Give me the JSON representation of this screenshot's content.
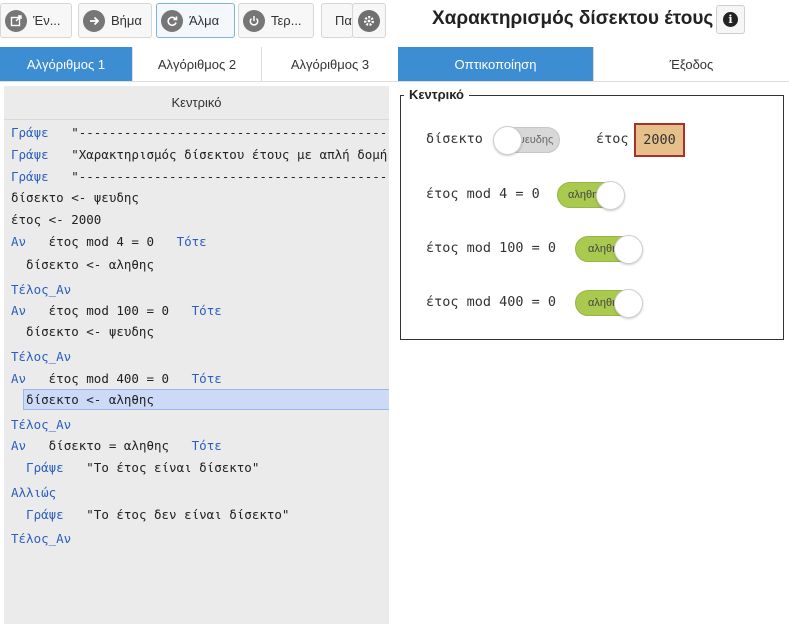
{
  "toolbar": {
    "buttons": [
      {
        "label": "Έν...",
        "icon": "export-icon"
      },
      {
        "label": "Βήμα",
        "icon": "arrow-right-icon"
      },
      {
        "label": "Άλμα",
        "icon": "redo-icon"
      },
      {
        "label": "Τερ...",
        "icon": "power-icon"
      },
      {
        "label": "Πα",
        "icon": ""
      },
      {
        "label": "",
        "icon": "gear-icon"
      }
    ]
  },
  "app": {
    "title": "Χαρακτηρισμός δίσεκτου έτους",
    "info_icon": "info-icon"
  },
  "tabs_left": [
    "Αλγόριθμος 1",
    "Αλγόριθμος 2",
    "Αλγόριθμος 3"
  ],
  "tabs_right": [
    "Οπτικοποίηση",
    "Έξοδος"
  ],
  "code": {
    "header": "Κεντρικό",
    "lines": [
      {
        "kw": "Γράψε",
        "text": "   \"--------------------------------------------------"
      },
      {
        "kw": "Γράψε",
        "text": "   \"Χαρακτηρισμός δίσεκτου έτους με απλή δομή"
      },
      {
        "kw": "Γράψε",
        "text": "   \"--------------------------------------------------"
      },
      {
        "kw": "",
        "text": "δίσεκτο <- ψευδης"
      },
      {
        "kw": "",
        "text": "έτος <- 2000"
      },
      {
        "kw": "Αν",
        "text": "   έτος mod 4 = 0   ",
        "kw2": "Τότε"
      },
      {
        "kw": "",
        "text": "  δίσεκτο <- αληθης"
      },
      {
        "kw": "Τέλος_Αν",
        "text": ""
      },
      {
        "kw": "Αν",
        "text": "   έτος mod 100 = 0   ",
        "kw2": "Τότε"
      },
      {
        "kw": "",
        "text": "  δίσεκτο <- ψευδης"
      },
      {
        "kw": "Τέλος_Αν",
        "text": ""
      },
      {
        "kw": "Αν",
        "text": "   έτος mod 400 = 0   ",
        "kw2": "Τότε"
      },
      {
        "kw": "",
        "text": "  δίσεκτο <- αληθης"
      },
      {
        "kw": "Τέλος_Αν",
        "text": ""
      },
      {
        "kw": "Αν",
        "text": "   δίσεκτο = αληθης   ",
        "kw2": "Τότε"
      },
      {
        "kw": "  Γράψε",
        "text": "   \"Το έτος είναι δίσεκτο\""
      },
      {
        "kw": "Αλλιώς",
        "text": ""
      },
      {
        "kw": "  Γράψε",
        "text": "   \"Το έτος δεν είναι δίσεκτο\""
      },
      {
        "kw": "Τέλος_Αν",
        "text": ""
      }
    ]
  },
  "viz": {
    "legend": "Κεντρικό",
    "var_disekto": {
      "label": "δίσεκτο",
      "toggle_text": "ψευδης",
      "value": false
    },
    "var_etos": {
      "label": "έτος",
      "value": "2000"
    },
    "conditions": [
      {
        "label": "έτος mod 4 = 0",
        "toggle_text": "αληθης",
        "value": true
      },
      {
        "label": "έτος mod 100 = 0",
        "toggle_text": "αληθης",
        "value": true
      },
      {
        "label": "έτος mod 400 = 0",
        "toggle_text": "αληθης",
        "value": true
      }
    ]
  },
  "colors": {
    "accent": "#3d8dd2",
    "keyword": "#2a5fbf",
    "toggle_on": "#a9c94f",
    "highlight": "#ccd9f7",
    "year_bg": "#e6c08a",
    "year_border": "#a8322a"
  }
}
